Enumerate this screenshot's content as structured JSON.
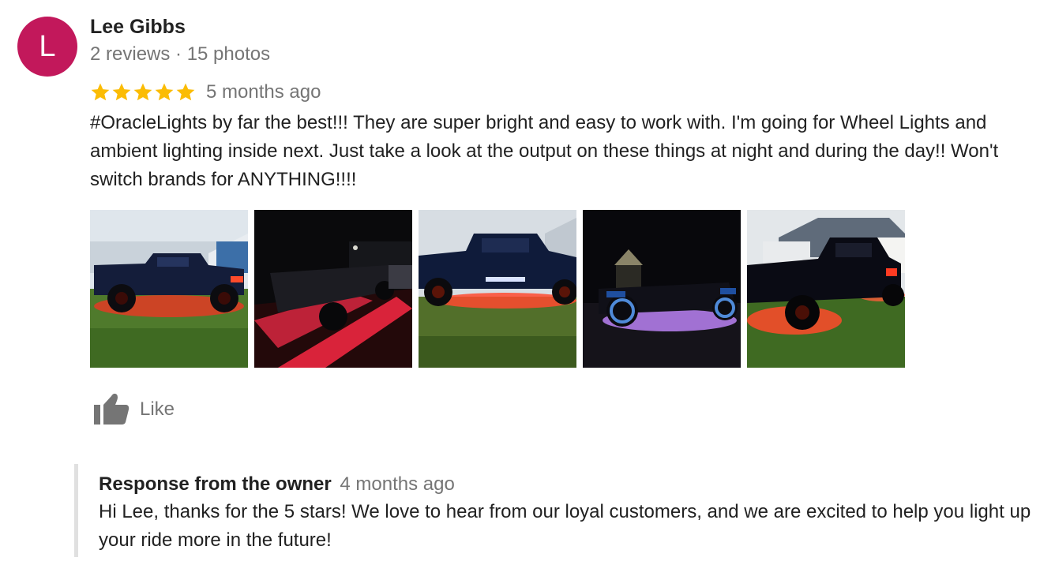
{
  "reviewer": {
    "initial": "L",
    "name": "Lee Gibbs",
    "meta": "2 reviews · 15 photos",
    "avatar_color": "#c2185b"
  },
  "review": {
    "rating": 5,
    "rating_max": 5,
    "star_color": "#fbbc04",
    "time": "5 months ago",
    "text": "#OracleLights by far the best!!! They are super bright and easy to work with. I'm going for Wheel Lights and ambient lighting inside next. Just take a look at the output on these things at night and during the day!! Won't switch brands for ANYTHING!!!!",
    "photos": [
      {
        "icon": "truck-red-underglow-day-photo"
      },
      {
        "icon": "truck-red-underglow-night-photo"
      },
      {
        "icon": "truck-red-underglow-front-photo"
      },
      {
        "icon": "truck-purple-underglow-night-photo"
      },
      {
        "icon": "truck-red-underglow-rear-photo"
      }
    ]
  },
  "actions": {
    "like_label": "Like",
    "like_icon": "thumbs-up-icon"
  },
  "owner_response": {
    "title": "Response from the owner",
    "time": "4 months ago",
    "text": "Hi Lee, thanks for the 5 stars! We love to hear from our loyal customers, and we are excited to help you light up your ride more in the future!"
  }
}
